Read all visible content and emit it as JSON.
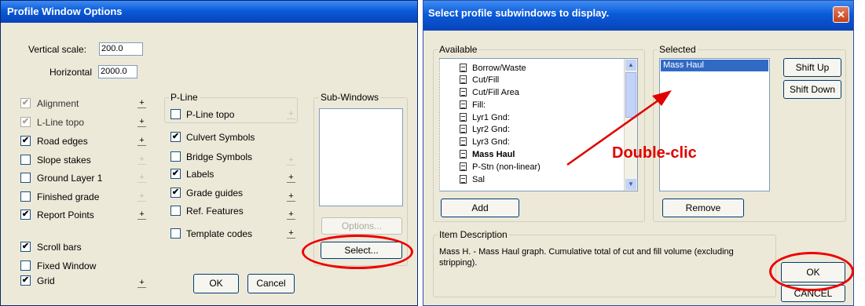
{
  "left_dialog": {
    "title": "Profile Window Options",
    "vertical_scale_label": "Vertical scale:",
    "vertical_scale_value": "200.0",
    "horizontal_label": "Horizontal",
    "horizontal_value": "2000.0",
    "options": [
      {
        "label": "Alignment",
        "checked": true,
        "disabled": true
      },
      {
        "label": "L-Line topo",
        "checked": true,
        "disabled": true
      },
      {
        "label": "Road edges",
        "checked": true
      },
      {
        "label": "Slope stakes",
        "checked": false
      },
      {
        "label": "Ground Layer 1",
        "checked": false
      },
      {
        "label": "Finished grade",
        "checked": false
      },
      {
        "label": "Report Points",
        "checked": true
      }
    ],
    "pline_group_label": "P-Line",
    "pline_options": [
      {
        "label": "P-Line topo",
        "checked": false
      },
      {
        "label": "Culvert Symbols",
        "checked": true
      },
      {
        "label": "Bridge Symbols",
        "checked": false
      },
      {
        "label": "Labels",
        "checked": true
      },
      {
        "label": "Grade guides",
        "checked": true
      },
      {
        "label": "Ref. Features",
        "checked": false
      },
      {
        "label": "Template codes",
        "checked": false
      }
    ],
    "subwindows_group_label": "Sub-Windows",
    "options_button": "Options...",
    "select_button": "Select...",
    "bottom_options": [
      {
        "label": "Scroll bars",
        "checked": true
      },
      {
        "label": "Fixed Window",
        "checked": false
      },
      {
        "label": "Grid",
        "checked": true
      }
    ],
    "ok_button": "OK",
    "cancel_button": "Cancel",
    "plus_glyph": "+",
    "check_glyph": "✔"
  },
  "right_dialog": {
    "title": "Select profile subwindows to display.",
    "close_glyph": "✕",
    "available_label": "Available",
    "available_items": [
      "Borrow/Waste",
      "Cut/Fill",
      "Cut/Fill Area",
      "Fill:",
      "Lyr1 Gnd:",
      "Lyr2 Gnd:",
      "Lyr3 Gnd:",
      "Mass Haul",
      "P-Stn (non-linear)",
      "Sal"
    ],
    "selected_label": "Selected",
    "selected_items": [
      "Mass Haul"
    ],
    "shift_up_button": "Shift Up",
    "shift_down_button": "Shift Down",
    "add_button": "Add",
    "remove_button": "Remove",
    "item_description_label": "Item Description",
    "item_description_text": "Mass H. - Mass Haul graph. Cumulative total of cut and fill volume (excluding stripping).",
    "ok_button": "OK",
    "cancel_button": "CANCEL"
  },
  "annotation": {
    "text": "Double-clic",
    "color": "#e00000"
  }
}
